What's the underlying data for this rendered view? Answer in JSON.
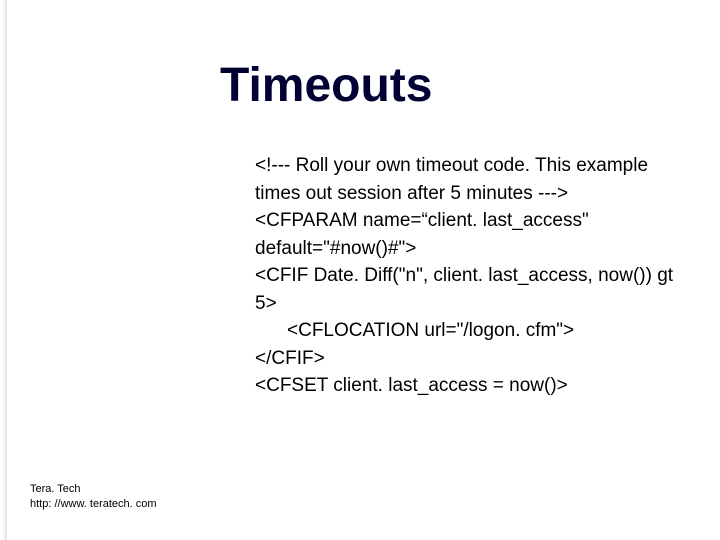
{
  "slide": {
    "title": "Timeouts"
  },
  "code": {
    "l1": "<!--- Roll your own timeout code. This example times out session after 5 minutes --->",
    "l2": "<CFPARAM name=“client. last_access\" default=\"#now()#\">",
    "l3": "<CFIF Date. Diff(\"n\", client. last_access, now()) gt 5>",
    "l4": "<CFLOCATION url=\"/logon. cfm\">",
    "l5": "</CFIF>",
    "l6": "<CFSET client. last_access = now()>"
  },
  "footer": {
    "company": "Tera. Tech",
    "url": "http: //www. teratech. com"
  }
}
